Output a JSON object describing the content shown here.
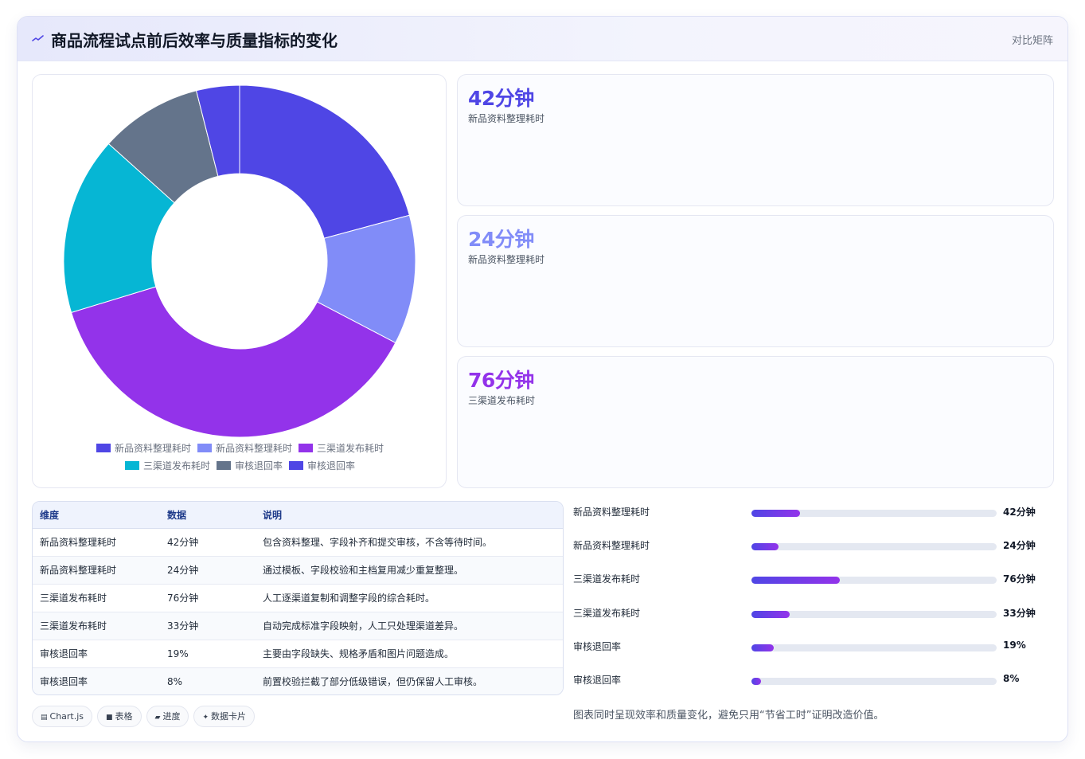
{
  "header": {
    "title": "商品流程试点前后效率与质量指标的变化",
    "right_label": "对比矩阵"
  },
  "colors": {
    "indigo": "#4f46e5",
    "light_indigo": "#818cf8",
    "purple": "#9333ea",
    "cyan": "#06b6d4",
    "slate": "#64748b"
  },
  "chart_data": {
    "type": "pie",
    "donut": true,
    "labels": [
      "新品资料整理耗时",
      "新品资料整理耗时",
      "三渠道发布耗时",
      "三渠道发布耗时",
      "审核退回率",
      "审核退回率"
    ],
    "values": [
      42,
      24,
      76,
      33,
      19,
      8
    ],
    "colors": [
      "#4f46e5",
      "#818cf8",
      "#9333ea",
      "#06b6d4",
      "#64748b",
      "#4f46e5"
    ],
    "legend": "bottom"
  },
  "stats": [
    {
      "value": "42分钟",
      "label": "新品资料整理耗时",
      "color": "#4f46e5"
    },
    {
      "value": "24分钟",
      "label": "新品资料整理耗时",
      "color": "#818cf8"
    },
    {
      "value": "76分钟",
      "label": "三渠道发布耗时",
      "color": "#9333ea"
    }
  ],
  "table": {
    "headers": [
      "维度",
      "数据",
      "说明"
    ],
    "rows": [
      [
        "新品资料整理耗时",
        "42分钟",
        "包含资料整理、字段补齐和提交审核，不含等待时间。"
      ],
      [
        "新品资料整理耗时",
        "24分钟",
        "通过模板、字段校验和主档复用减少重复整理。"
      ],
      [
        "三渠道发布耗时",
        "76分钟",
        "人工逐渠道复制和调整字段的综合耗时。"
      ],
      [
        "三渠道发布耗时",
        "33分钟",
        "自动完成标准字段映射，人工只处理渠道差异。"
      ],
      [
        "审核退回率",
        "19%",
        "主要由字段缺失、规格矛盾和图片问题造成。"
      ],
      [
        "审核退回率",
        "8%",
        "前置校验拦截了部分低级错误，但仍保留人工审核。"
      ]
    ]
  },
  "progress": [
    {
      "label": "新品资料整理耗时",
      "value": "42分钟",
      "fraction": 0.198
    },
    {
      "label": "新品资料整理耗时",
      "value": "24分钟",
      "fraction": 0.112
    },
    {
      "label": "三渠道发布耗时",
      "value": "76分钟",
      "fraction": 0.36
    },
    {
      "label": "三渠道发布耗时",
      "value": "33分钟",
      "fraction": 0.156
    },
    {
      "label": "审核退回率",
      "value": "19%",
      "fraction": 0.09
    },
    {
      "label": "审核退回率",
      "value": "8%",
      "fraction": 0.038
    }
  ],
  "note": "图表同时呈现效率和质量变化，避免只用“节省工时”证明改造价值。",
  "chips": [
    {
      "icon": "chart-icon",
      "glyph": "▤",
      "label": "Chart.js"
    },
    {
      "icon": "table-icon",
      "glyph": "■",
      "label": "表格"
    },
    {
      "icon": "progress-icon",
      "glyph": "▰",
      "label": "进度"
    },
    {
      "icon": "card-icon",
      "glyph": "✦",
      "label": "数据卡片"
    }
  ]
}
